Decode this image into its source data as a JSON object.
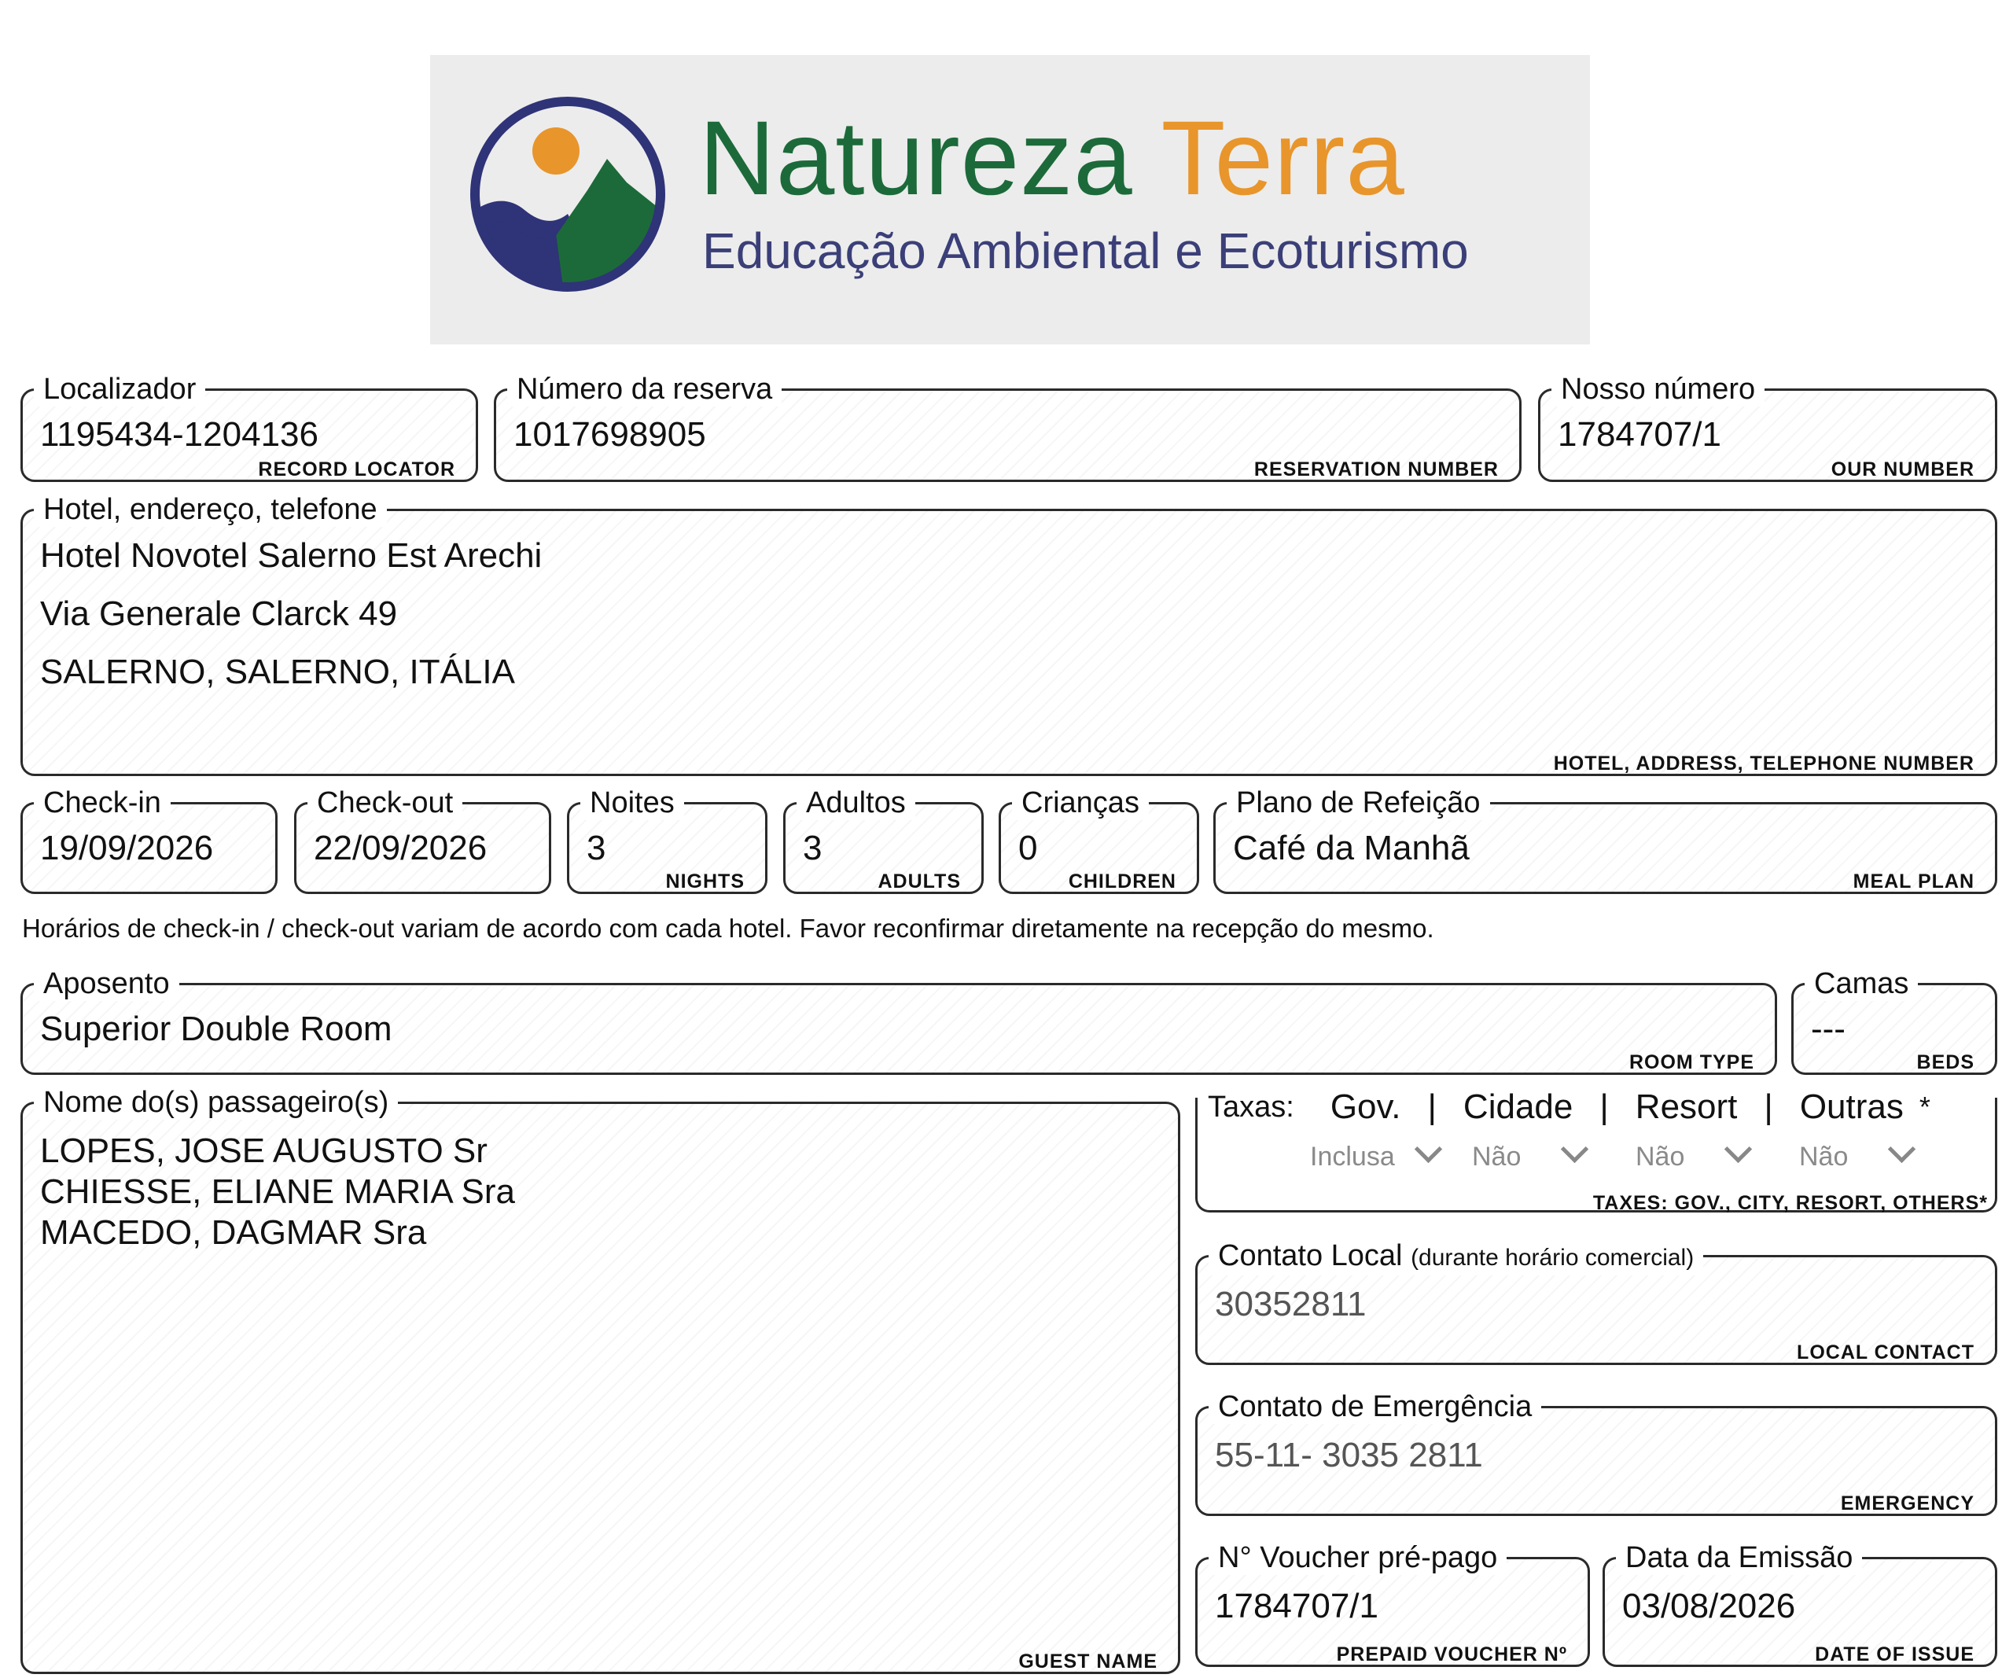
{
  "logo": {
    "brand_word1": "Natureza",
    "brand_word2": "Terra",
    "tagline": "Educação Ambiental e Ecoturismo",
    "colors": {
      "green": "#1c6a3a",
      "orange": "#e8952b",
      "navy": "#2f3377"
    }
  },
  "record_locator": {
    "label": "Localizador",
    "value": "1195434-1204136",
    "sub": "RECORD LOCATOR"
  },
  "reservation": {
    "label": "Número da reserva",
    "value": "1017698905",
    "sub": "RESERVATION NUMBER"
  },
  "our_number": {
    "label": "Nosso número",
    "value": "1784707/1",
    "sub": "OUR NUMBER"
  },
  "hotel": {
    "label": "Hotel, endereço, telefone",
    "lines": [
      "Hotel Novotel Salerno Est Arechi",
      "Via Generale Clarck 49",
      "SALERNO, SALERNO, ITÁLIA"
    ],
    "sub": "HOTEL, ADDRESS, TELEPHONE NUMBER"
  },
  "checkin": {
    "label": "Check-in",
    "value": "19/09/2026"
  },
  "checkout": {
    "label": "Check-out",
    "value": "22/09/2026"
  },
  "nights": {
    "label": "Noites",
    "value": "3",
    "sub": "NIGHTS"
  },
  "adults": {
    "label": "Adultos",
    "value": "3",
    "sub": "ADULTS"
  },
  "children": {
    "label": "Crianças",
    "value": "0",
    "sub": "CHILDREN"
  },
  "meal": {
    "label": "Plano de Refeição",
    "value": "Café da Manhã",
    "sub": "MEAL PLAN"
  },
  "note": "Horários de check-in / check-out variam de acordo com cada hotel. Favor reconfirmar diretamente na recepção do mesmo.",
  "room": {
    "label": "Aposento",
    "value": "Superior Double Room",
    "sub": "ROOM TYPE"
  },
  "beds": {
    "label": "Camas",
    "value": "---",
    "sub": "BEDS"
  },
  "guests": {
    "label": "Nome do(s) passageiro(s)",
    "names": [
      "LOPES, JOSE AUGUSTO Sr",
      "CHIESSE, ELIANE MARIA Sra",
      "MACEDO, DAGMAR Sra"
    ],
    "sub": "GUEST NAME"
  },
  "taxes": {
    "label": "Taxas:",
    "headers": [
      "Gov.",
      "Cidade",
      "Resort",
      "Outras"
    ],
    "separator": "|",
    "asterisk": "*",
    "values": [
      "Inclusa",
      "Não",
      "Não",
      "Não"
    ],
    "sub": "TAXES: GOV., CITY, RESORT, OTHERS*"
  },
  "local_contact": {
    "label": "Contato Local",
    "label_note": "(durante horário comercial)",
    "value": "30352811",
    "sub": "LOCAL CONTACT"
  },
  "emergency": {
    "label": "Contato de Emergência",
    "value": "55-11- 3035 2811",
    "sub": "EMERGENCY"
  },
  "voucher": {
    "label": "N° Voucher pré-pago",
    "value": "1784707/1",
    "sub": "PREPAID VOUCHER Nº"
  },
  "issue": {
    "label": "Data da Emissão",
    "value": "03/08/2026",
    "sub": "DATE OF ISSUE"
  }
}
